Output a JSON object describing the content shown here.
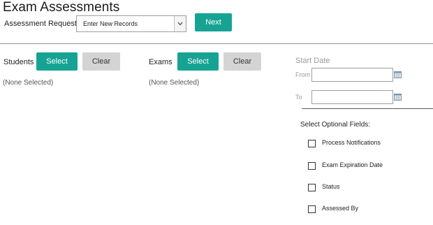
{
  "page": {
    "title": "Exam Assessments"
  },
  "request": {
    "label": "Assessment Request:",
    "selected": "Enter New Records",
    "next_label": "Next"
  },
  "students": {
    "label": "Students",
    "select_label": "Select",
    "clear_label": "Clear",
    "none_text": "(None Selected)"
  },
  "exams": {
    "label": "Exams",
    "select_label": "Select",
    "clear_label": "Clear",
    "none_text": "(None Selected)"
  },
  "start_date": {
    "heading": "Start Date",
    "from_label": "From",
    "to_label": "To",
    "from_value": "",
    "to_value": ""
  },
  "optional_fields": {
    "heading": "Select Optional Fields:",
    "items": [
      {
        "label": "Process Notifications",
        "checked": false
      },
      {
        "label": "Exam Expiration Date",
        "checked": false
      },
      {
        "label": "Status",
        "checked": false
      },
      {
        "label": "Assessed By",
        "checked": false
      }
    ]
  },
  "icons": {
    "dropdown": "chevron-down-icon",
    "calendar": "calendar-icon"
  },
  "colors": {
    "primary_button": "#17a394",
    "secondary_button": "#d4d4d4"
  }
}
